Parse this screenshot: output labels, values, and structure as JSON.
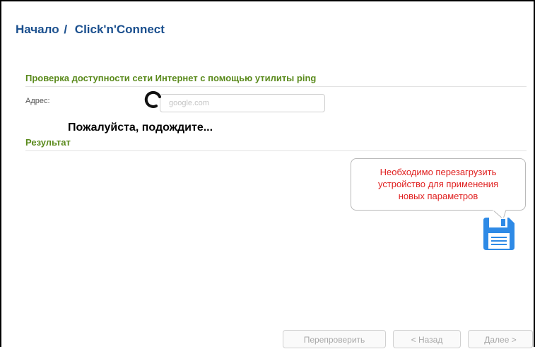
{
  "breadcrumb": {
    "home": "Начало",
    "separator": "/",
    "current": "Click'n'Connect"
  },
  "ping_section": {
    "title": "Проверка доступности сети Интернет с помощью утилиты ping",
    "address_label": "Адрес:",
    "address_placeholder": "google.com"
  },
  "loading": {
    "text": "Пожалуйста, подождите..."
  },
  "result_section": {
    "title": "Результат"
  },
  "notification": {
    "lines": [
      "Необходимо перезагрузить",
      "устройство для применения",
      "новых параметров"
    ]
  },
  "buttons": {
    "recheck": "Перепроверить",
    "back": "< Назад",
    "next": "Далее >"
  },
  "colors": {
    "breadcrumb": "#1a4f8e",
    "section_title": "#5a8a1c",
    "notification_text": "#e02020",
    "save_icon": "#2e8ae6"
  },
  "icons": {
    "spinner": "loading-spinner-icon",
    "save": "floppy-disk-icon"
  }
}
